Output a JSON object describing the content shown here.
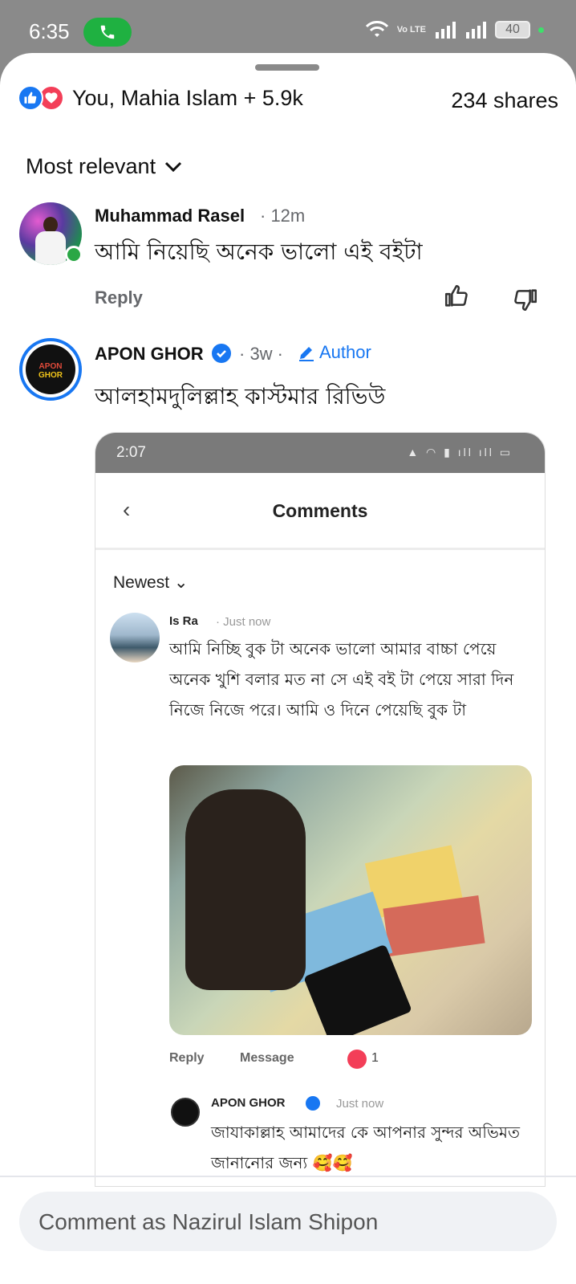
{
  "status_bar": {
    "time": "6:35",
    "network_label": "Vo LTE",
    "battery": "40",
    "call_color": "#1fb141"
  },
  "reactions": {
    "summary": "You, Mahia Islam + 5.9k",
    "shares": "234 shares",
    "like_color": "#1877f2",
    "love_color": "#f33e58"
  },
  "sort": {
    "label": "Most relevant"
  },
  "comments": [
    {
      "name": "Muhammad Rasel",
      "time": "· 12m",
      "text": "আমি নিয়েছি অনেক ভালো এই বইটা",
      "reply": "Reply"
    },
    {
      "name": "APON GHOR",
      "time": "· 3w ·",
      "badge": "Author",
      "text": "আলহামদুলিল্লাহ কাস্টমার রিভিউ"
    }
  ],
  "embedded": {
    "time": "2:07",
    "title": "Comments",
    "sort": "Newest",
    "comment": {
      "name": "Is Ra",
      "time": "· Just now",
      "text": "আমি নিচ্ছি বুক টা অনেক ভালো আমার বাচ্চা পেয়ে অনেক খুশি বলার মত না সে এই বই টা পেয়ে সারা দিন নিজে নিজে পরে। আমি ও দিনে পেয়েছি বুক টা",
      "reply": "Reply",
      "message": "Message",
      "reaction_count": "1"
    },
    "reply_comment": {
      "name": "APON GHOR",
      "time": "Just now",
      "text": "জাযাকাল্লাহ আমাদের কে আপনার সুন্দর অভিমত জানানোর জন্য 🥰🥰"
    }
  },
  "composer": {
    "placeholder": "Comment as Nazirul Islam Shipon"
  }
}
